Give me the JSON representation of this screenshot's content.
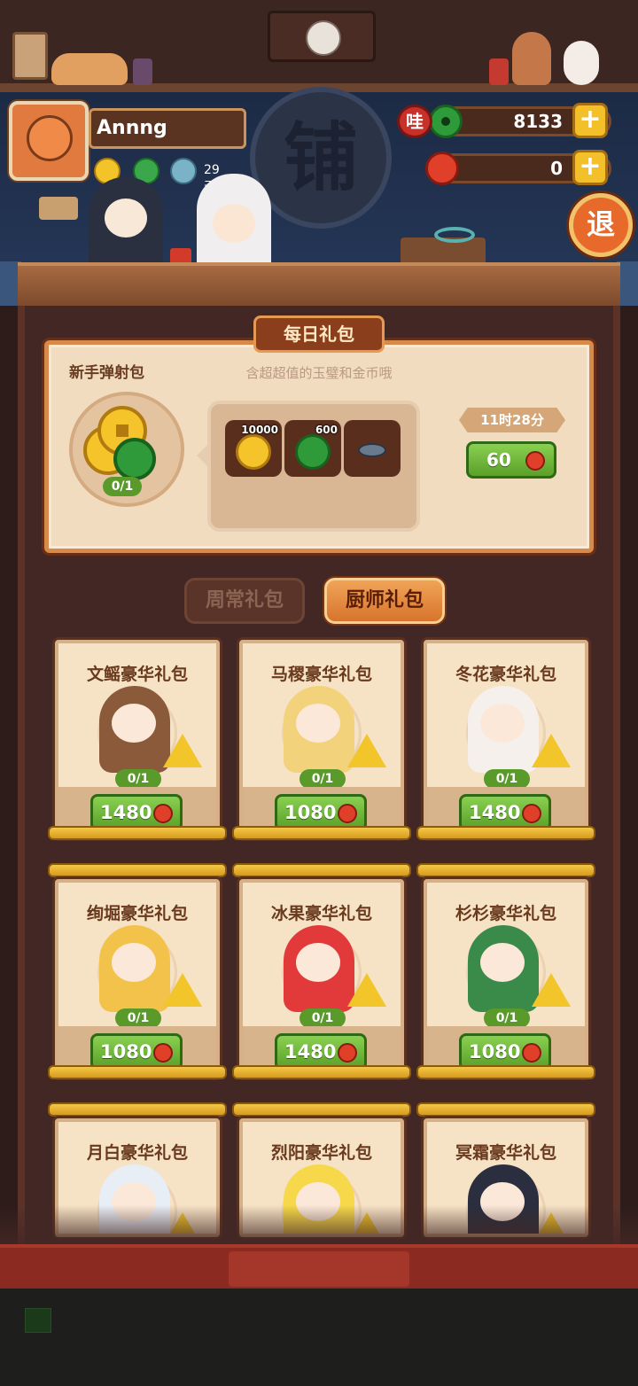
{
  "shop": {
    "sign_char": "铺",
    "exit_label": "退"
  },
  "player": {
    "name": "Annng",
    "days_label": "29天"
  },
  "currency": {
    "wa_label": "哇",
    "jade_amount": "8133",
    "red_gem_amount": "0",
    "plus_label": "+"
  },
  "daily": {
    "title": "每日礼包",
    "pack_name": "新手弹射包",
    "description": "含超超值的玉璧和金币哦",
    "count": "0/1",
    "items": [
      {
        "icon": "gold-coin-icon",
        "qty": "10000"
      },
      {
        "icon": "jade-icon",
        "qty": "600"
      },
      {
        "icon": "disc-icon",
        "qty": ""
      }
    ],
    "timer": "11时28分",
    "price": "60"
  },
  "tabs": [
    {
      "label": "周常礼包",
      "active": false
    },
    {
      "label": "厨师礼包",
      "active": true
    }
  ],
  "packs": [
    {
      "title": "文鳐豪华礼包",
      "count": "0/1",
      "price": "1480"
    },
    {
      "title": "马稷豪华礼包",
      "count": "0/1",
      "price": "1080"
    },
    {
      "title": "冬花豪华礼包",
      "count": "0/1",
      "price": "1480"
    },
    {
      "title": "绚堀豪华礼包",
      "count": "0/1",
      "price": "1080"
    },
    {
      "title": "冰果豪华礼包",
      "count": "0/1",
      "price": "1480"
    },
    {
      "title": "杉杉豪华礼包",
      "count": "0/1",
      "price": "1080"
    },
    {
      "title": "月白豪华礼包",
      "count": "",
      "price": ""
    },
    {
      "title": "烈阳豪华礼包",
      "count": "",
      "price": ""
    },
    {
      "title": "冥霜豪华礼包",
      "count": "",
      "price": ""
    }
  ],
  "colors": {
    "accent_green": "#5aa02a",
    "accent_orange": "#d8742c",
    "gold": "#f4c42a",
    "jade": "#2e9a3a",
    "red_gem": "#e0402a"
  }
}
